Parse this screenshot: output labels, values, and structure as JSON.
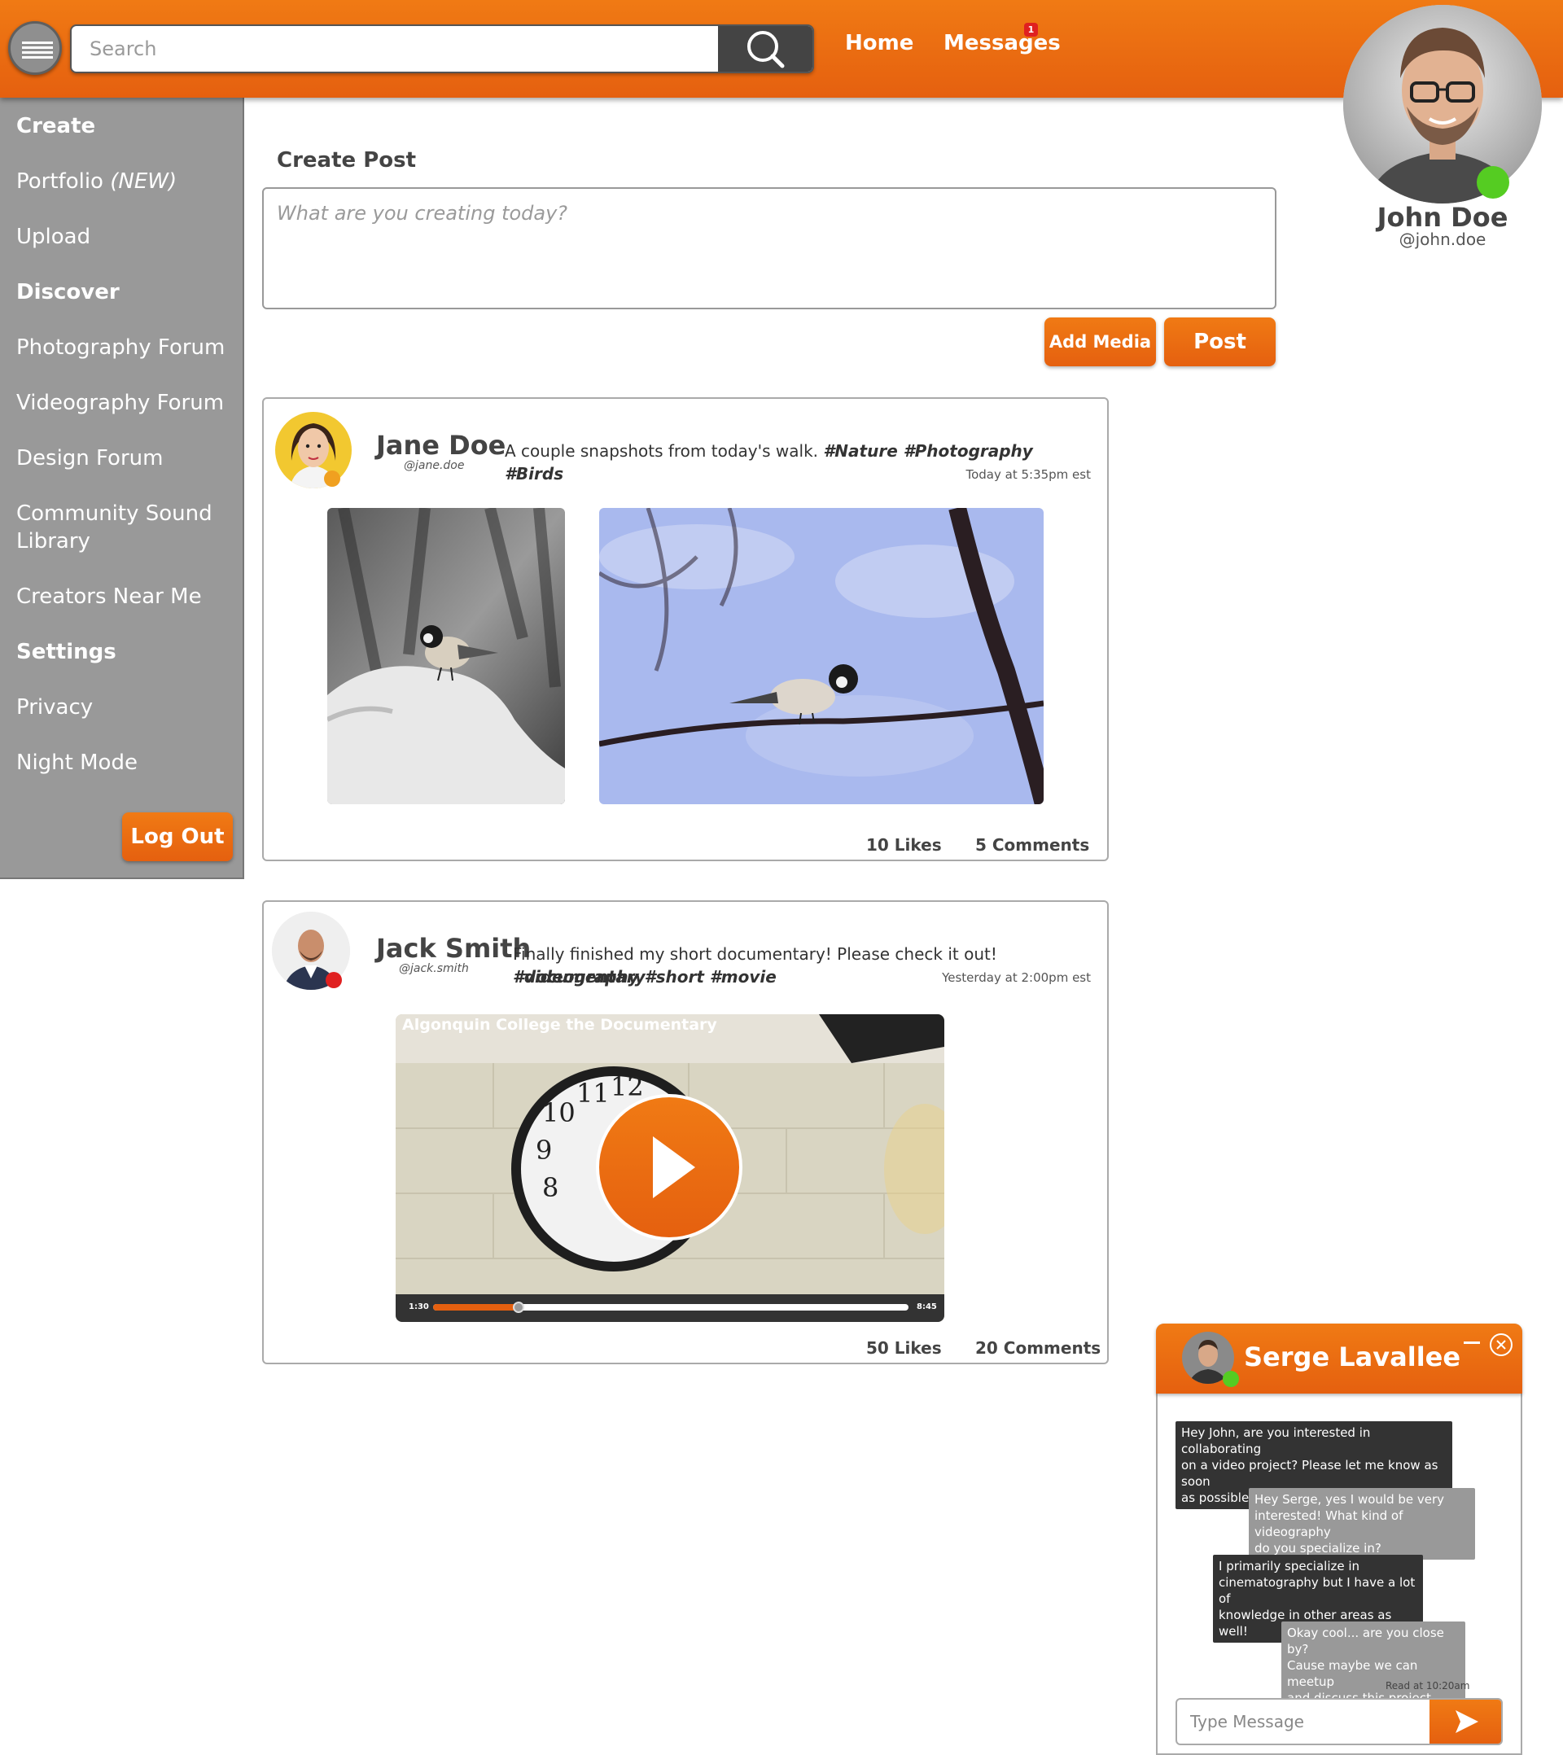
{
  "header": {
    "search_placeholder": "Search",
    "nav": {
      "home": "Home",
      "messages": "Messages",
      "messages_badge": "1"
    }
  },
  "profile": {
    "name": "John Doe",
    "handle": "@john.doe",
    "status_color": "#55cc22"
  },
  "sidebar": {
    "items": [
      {
        "label": "Create",
        "heading": true
      },
      {
        "label": "Portfolio",
        "suffix": "(NEW)"
      },
      {
        "label": "Upload"
      },
      {
        "label": "Discover",
        "heading": true
      },
      {
        "label": "Photography Forum"
      },
      {
        "label": "Videography Forum"
      },
      {
        "label": "Design Forum"
      },
      {
        "label": "Community Sound Library"
      },
      {
        "label": "Creators Near Me"
      },
      {
        "label": "Settings",
        "heading": true
      },
      {
        "label": "Privacy"
      },
      {
        "label": "Night Mode"
      }
    ],
    "logout": "Log Out"
  },
  "create_post": {
    "title": "Create Post",
    "placeholder": "What are you creating today?",
    "add_media": "Add Media",
    "post": "Post"
  },
  "posts": [
    {
      "name": "Jane Doe",
      "handle": "@jane.doe",
      "text": "A couple snapshots from today's walk.",
      "tags": "#Nature #Photography #Birds",
      "time": "Today at 5:35pm est",
      "likes": "10 Likes",
      "comments": "5 Comments",
      "status_color": "#f0a020"
    },
    {
      "name": "Jack Smith",
      "handle": "@jack.smith",
      "text": "Finally finished my short documentary! Please check it out!",
      "tags_line1": "#documentary",
      "tags_line2": "#videography #short #movie",
      "time": "Yesterday at 2:00pm est",
      "video": {
        "title": "Algonquin College the Documentary",
        "current": "1:30",
        "duration": "8:45",
        "progress": 0.18
      },
      "likes": "50 Likes",
      "comments": "20 Comments",
      "status_color": "#e02020"
    }
  ],
  "chat": {
    "name": "Serge Lavallee",
    "messages": [
      {
        "from": "them",
        "lines": [
          "Hey John, are you interested in collaborating",
          "on a video project? Please let me know as soon",
          "as possible! Thanks, Serge"
        ]
      },
      {
        "from": "me",
        "lines": [
          "Hey Serge, yes I would be very",
          "interested! What kind of videography",
          "do you specialize in?"
        ]
      },
      {
        "from": "them",
        "lines": [
          "I primarily specialize in",
          "cinematography but I have a lot of",
          "knowledge in other areas as well!"
        ]
      },
      {
        "from": "me",
        "lines": [
          "Okay cool... are you close by?",
          "Cause maybe we can meetup",
          "and discuss this project."
        ]
      }
    ],
    "read_at": "Read at 10:20am",
    "input_placeholder": "Type Message"
  },
  "colors": {
    "accent": "#e5600f",
    "sidebar": "#999999",
    "dark": "#444444"
  }
}
